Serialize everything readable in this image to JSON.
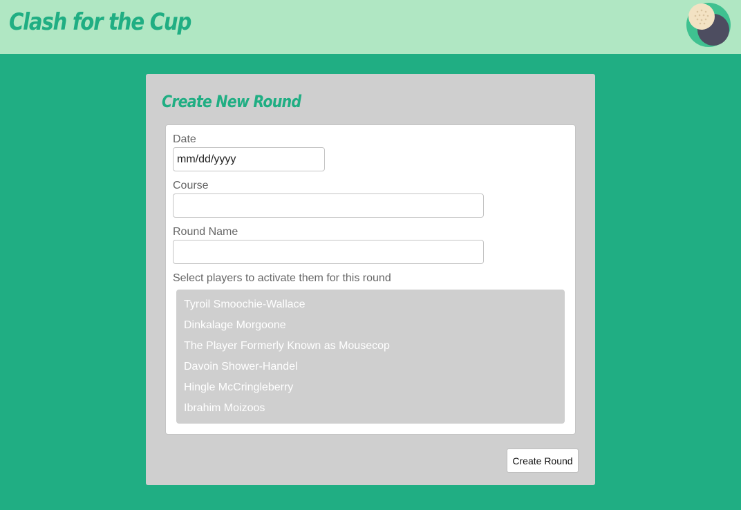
{
  "header": {
    "title": "Clash for the Cup",
    "logo_icon": "golf-ball-logo-icon"
  },
  "form": {
    "title": "Create New Round",
    "date_label": "Date",
    "date_placeholder": "mm/dd/yyyy",
    "course_label": "Course",
    "course_value": "",
    "round_name_label": "Round Name",
    "round_name_value": "",
    "players_label": "Select players to activate them for this round",
    "players": [
      "Tyroil Smoochie-Wallace",
      "Dinkalage Morgoone",
      "The Player Formerly Known as Mousecop",
      "Davoin Shower-Handel",
      "Hingle McCringleberry",
      "Ibrahim Moizoos"
    ],
    "submit_label": "Create Round"
  },
  "colors": {
    "background": "#20ae83",
    "header_background": "#b0e7c3",
    "card_background": "#cfcfcf",
    "accent": "#20ae83"
  }
}
